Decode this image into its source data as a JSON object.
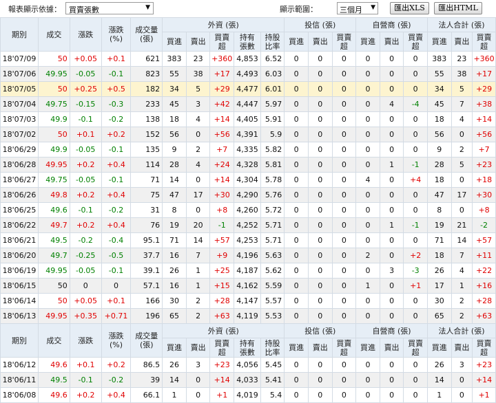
{
  "toolbar": {
    "report_label": "報表顯示依據：",
    "report_value": "買賣張數",
    "range_label": "顯示範圍：",
    "range_value": "三個月",
    "export_xls": "匯出XLS",
    "export_html": "匯出HTML"
  },
  "headers": {
    "date": "期別",
    "close": "成交",
    "change": "漲跌",
    "change_pct": "漲跌\n(%)",
    "volume": "成交量\n(張)",
    "foreign": "外資 (張)",
    "trust": "投信 (張)",
    "dealer": "自營商 (張)",
    "total": "法人合計 (張)",
    "buy": "買進",
    "sell": "賣出",
    "net": "買賣\n超",
    "holding": "持有\n張數",
    "ratio": "持股\n比率"
  },
  "rows": [
    [
      "18'07/09",
      "50",
      "+0.05",
      "+0.1",
      "621",
      "383",
      "23",
      "+360",
      "4,853",
      "6.52",
      "0",
      "0",
      "0",
      "0",
      "0",
      "0",
      "383",
      "23",
      "+360"
    ],
    [
      "18'07/06",
      "49.95",
      "-0.05",
      "-0.1",
      "823",
      "55",
      "38",
      "+17",
      "4,493",
      "6.03",
      "0",
      "0",
      "0",
      "0",
      "0",
      "0",
      "55",
      "38",
      "+17"
    ],
    [
      "18'07/05",
      "50",
      "+0.25",
      "+0.5",
      "182",
      "34",
      "5",
      "+29",
      "4,477",
      "6.01",
      "0",
      "0",
      "0",
      "0",
      "0",
      "0",
      "34",
      "5",
      "+29"
    ],
    [
      "18'07/04",
      "49.75",
      "-0.15",
      "-0.3",
      "233",
      "45",
      "3",
      "+42",
      "4,447",
      "5.97",
      "0",
      "0",
      "0",
      "0",
      "4",
      "-4",
      "45",
      "7",
      "+38"
    ],
    [
      "18'07/03",
      "49.9",
      "-0.1",
      "-0.2",
      "138",
      "18",
      "4",
      "+14",
      "4,405",
      "5.91",
      "0",
      "0",
      "0",
      "0",
      "0",
      "0",
      "18",
      "4",
      "+14"
    ],
    [
      "18'07/02",
      "50",
      "+0.1",
      "+0.2",
      "152",
      "56",
      "0",
      "+56",
      "4,391",
      "5.9",
      "0",
      "0",
      "0",
      "0",
      "0",
      "0",
      "56",
      "0",
      "+56"
    ],
    [
      "18'06/29",
      "49.9",
      "-0.05",
      "-0.1",
      "135",
      "9",
      "2",
      "+7",
      "4,335",
      "5.82",
      "0",
      "0",
      "0",
      "0",
      "0",
      "0",
      "9",
      "2",
      "+7"
    ],
    [
      "18'06/28",
      "49.95",
      "+0.2",
      "+0.4",
      "114",
      "28",
      "4",
      "+24",
      "4,328",
      "5.81",
      "0",
      "0",
      "0",
      "0",
      "1",
      "-1",
      "28",
      "5",
      "+23"
    ],
    [
      "18'06/27",
      "49.75",
      "-0.05",
      "-0.1",
      "71",
      "14",
      "0",
      "+14",
      "4,304",
      "5.78",
      "0",
      "0",
      "0",
      "4",
      "0",
      "+4",
      "18",
      "0",
      "+18"
    ],
    [
      "18'06/26",
      "49.8",
      "+0.2",
      "+0.4",
      "75",
      "47",
      "17",
      "+30",
      "4,290",
      "5.76",
      "0",
      "0",
      "0",
      "0",
      "0",
      "0",
      "47",
      "17",
      "+30"
    ],
    [
      "18'06/25",
      "49.6",
      "-0.1",
      "-0.2",
      "31",
      "8",
      "0",
      "+8",
      "4,260",
      "5.72",
      "0",
      "0",
      "0",
      "0",
      "0",
      "0",
      "8",
      "0",
      "+8"
    ],
    [
      "18'06/22",
      "49.7",
      "+0.2",
      "+0.4",
      "76",
      "19",
      "20",
      "-1",
      "4,252",
      "5.71",
      "0",
      "0",
      "0",
      "0",
      "1",
      "-1",
      "19",
      "21",
      "-2"
    ],
    [
      "18'06/21",
      "49.5",
      "-0.2",
      "-0.4",
      "95.1",
      "71",
      "14",
      "+57",
      "4,253",
      "5.71",
      "0",
      "0",
      "0",
      "0",
      "0",
      "0",
      "71",
      "14",
      "+57"
    ],
    [
      "18'06/20",
      "49.7",
      "-0.25",
      "-0.5",
      "37.7",
      "16",
      "7",
      "+9",
      "4,196",
      "5.63",
      "0",
      "0",
      "0",
      "2",
      "0",
      "+2",
      "18",
      "7",
      "+11"
    ],
    [
      "18'06/19",
      "49.95",
      "-0.05",
      "-0.1",
      "39.1",
      "26",
      "1",
      "+25",
      "4,187",
      "5.62",
      "0",
      "0",
      "0",
      "0",
      "3",
      "-3",
      "26",
      "4",
      "+22"
    ],
    [
      "18'06/15",
      "50",
      "0",
      "0",
      "57.1",
      "16",
      "1",
      "+15",
      "4,162",
      "5.59",
      "0",
      "0",
      "0",
      "1",
      "0",
      "+1",
      "17",
      "1",
      "+16"
    ],
    [
      "18'06/14",
      "50",
      "+0.05",
      "+0.1",
      "166",
      "30",
      "2",
      "+28",
      "4,147",
      "5.57",
      "0",
      "0",
      "0",
      "0",
      "0",
      "0",
      "30",
      "2",
      "+28"
    ],
    [
      "18'06/13",
      "49.95",
      "+0.35",
      "+0.71",
      "196",
      "65",
      "2",
      "+63",
      "4,119",
      "5.53",
      "0",
      "0",
      "0",
      "0",
      "0",
      "0",
      "65",
      "2",
      "+63"
    ]
  ],
  "rows2": [
    [
      "18'06/12",
      "49.6",
      "+0.1",
      "+0.2",
      "86.5",
      "26",
      "3",
      "+23",
      "4,056",
      "5.45",
      "0",
      "0",
      "0",
      "0",
      "0",
      "0",
      "26",
      "3",
      "+23"
    ],
    [
      "18'06/11",
      "49.5",
      "-0.1",
      "-0.2",
      "39",
      "14",
      "0",
      "+14",
      "4,033",
      "5.41",
      "0",
      "0",
      "0",
      "0",
      "0",
      "0",
      "14",
      "0",
      "+14"
    ],
    [
      "18'06/08",
      "49.6",
      "+0.2",
      "+0.4",
      "66.1",
      "1",
      "0",
      "+1",
      "4,019",
      "5.4",
      "0",
      "0",
      "0",
      "0",
      "0",
      "0",
      "1",
      "0",
      "+1"
    ]
  ],
  "colors": {
    "header_bg": "#e6eef6",
    "positive": "#e00000",
    "negative": "#008000",
    "highlight": "#fdf4cf"
  }
}
